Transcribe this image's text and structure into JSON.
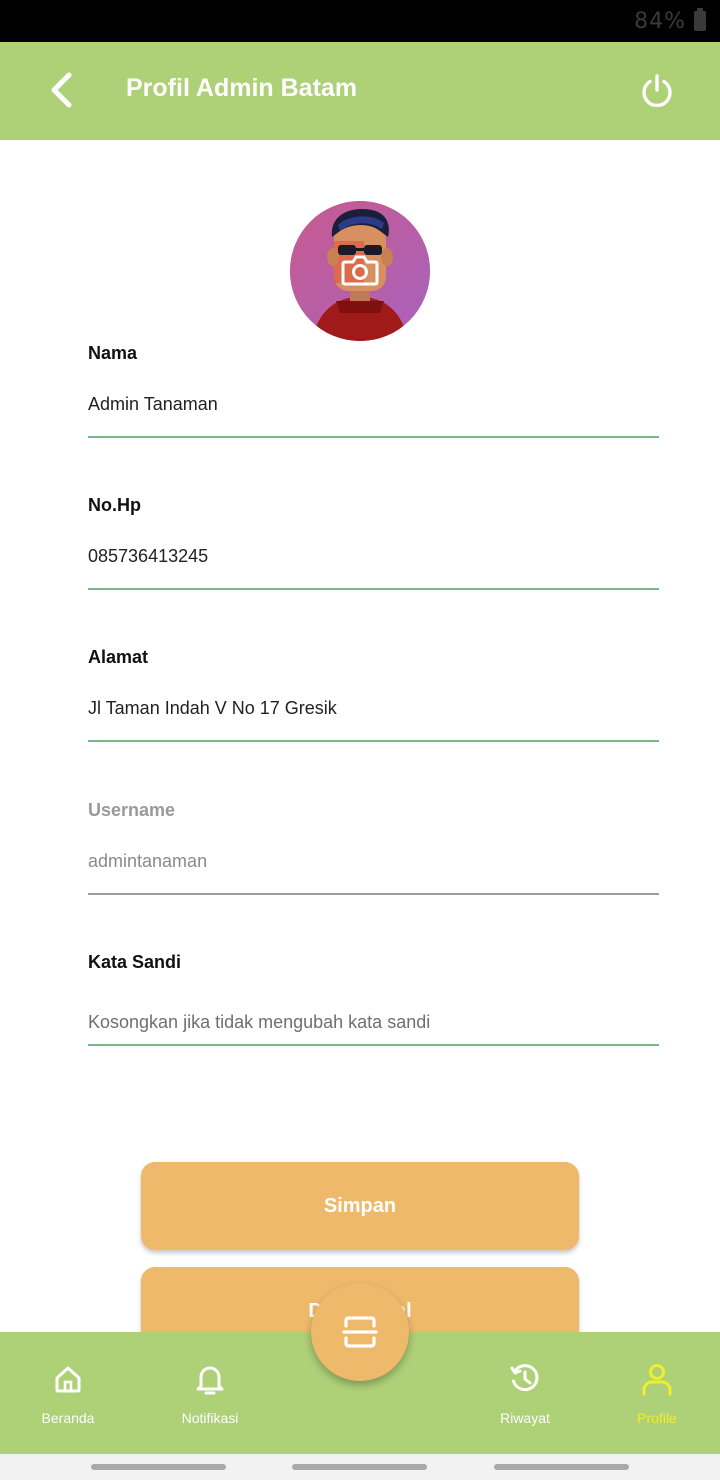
{
  "status_bar": {
    "battery": "84%"
  },
  "app_bar": {
    "title": "Profil Admin Batam"
  },
  "form": {
    "nama": {
      "label": "Nama",
      "value": "Admin Tanaman"
    },
    "no_hp": {
      "label": "No.Hp",
      "value": "085736413245"
    },
    "alamat": {
      "label": "Alamat",
      "value": "Jl Taman Indah V No 17 Gresik"
    },
    "username": {
      "label": "Username",
      "value": "admintanaman"
    },
    "kata_sandi": {
      "label": "Kata Sandi",
      "placeholder": "Kosongkan jika tidak mengubah kata sandi"
    }
  },
  "buttons": {
    "save": "Simpan",
    "second": "Daftar Jual"
  },
  "bottom_nav": {
    "items": [
      {
        "label": "Beranda",
        "icon": "home-icon"
      },
      {
        "label": "Notifikasi",
        "icon": "bell-icon"
      },
      {
        "label": "Riwayat",
        "icon": "history-icon"
      },
      {
        "label": "Profile",
        "icon": "user-icon",
        "active": true
      }
    ]
  },
  "colors": {
    "bar": "#aed077",
    "accent": "#efb96c",
    "active_nav": "#f3ee2b",
    "field_line": "#7ab78a"
  }
}
